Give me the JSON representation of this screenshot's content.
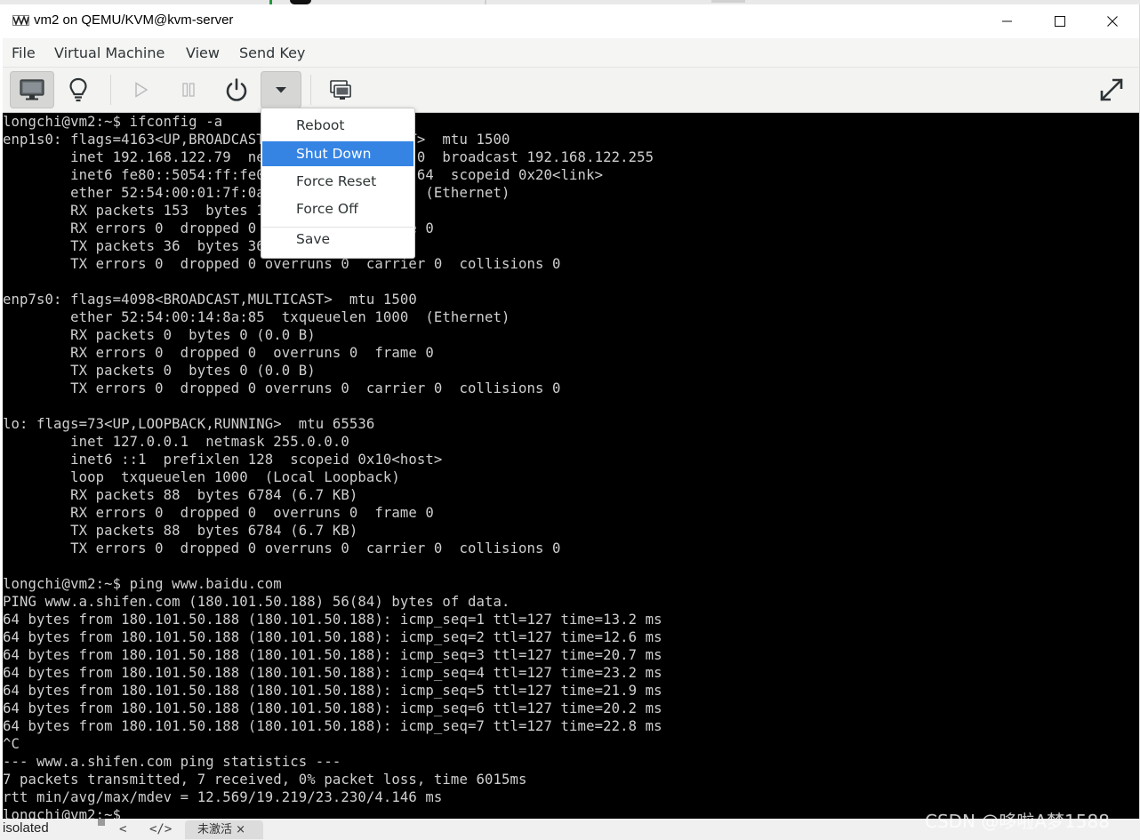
{
  "window": {
    "title": "vm2 on QEMU/KVM@kvm-server",
    "app_icon": "virt-manager-icon"
  },
  "menubar": {
    "items": [
      "File",
      "Virtual Machine",
      "View",
      "Send Key"
    ]
  },
  "toolbar": {
    "buttons": [
      "console-monitor",
      "details-lightbulb",
      "run",
      "pause",
      "power",
      "shutdown-dropdown",
      "snapshots",
      "fullscreen"
    ],
    "active": "console-monitor"
  },
  "shutdown_menu": {
    "items": [
      "Reboot",
      "Shut Down",
      "Force Reset",
      "Force Off",
      "Save"
    ],
    "highlighted": "Shut Down",
    "highlight_color": "#3584e4"
  },
  "console": {
    "text_color": "#cfcfcf",
    "background": "#000000",
    "lines": [
      "longchi@vm2:~$ ifconfig -a",
      "enp1s0: flags=4163<UP,BROADCAST,RUNNING,MULTICAST>  mtu 1500",
      "        inet 192.168.122.79  netmask 255.255.255.0  broadcast 192.168.122.255",
      "        inet6 fe80::5054:ff:fe01:7f0a  prefixlen 64  scopeid 0x20<link>",
      "        ether 52:54:00:01:7f:0a  txqueuelen 1000  (Ethernet)",
      "        RX packets 153  bytes 16520 (16.5 KB)",
      "        RX errors 0  dropped 0  overruns 0  frame 0",
      "        TX packets 36  bytes 3608 (3.6 KB)",
      "        TX errors 0  dropped 0 overruns 0  carrier 0  collisions 0",
      "",
      "enp7s0: flags=4098<BROADCAST,MULTICAST>  mtu 1500",
      "        ether 52:54:00:14:8a:85  txqueuelen 1000  (Ethernet)",
      "        RX packets 0  bytes 0 (0.0 B)",
      "        RX errors 0  dropped 0  overruns 0  frame 0",
      "        TX packets 0  bytes 0 (0.0 B)",
      "        TX errors 0  dropped 0 overruns 0  carrier 0  collisions 0",
      "",
      "lo: flags=73<UP,LOOPBACK,RUNNING>  mtu 65536",
      "        inet 127.0.0.1  netmask 255.0.0.0",
      "        inet6 ::1  prefixlen 128  scopeid 0x10<host>",
      "        loop  txqueuelen 1000  (Local Loopback)",
      "        RX packets 88  bytes 6784 (6.7 KB)",
      "        RX errors 0  dropped 0  overruns 0  frame 0",
      "        TX packets 88  bytes 6784 (6.7 KB)",
      "        TX errors 0  dropped 0 overruns 0  carrier 0  collisions 0",
      "",
      "longchi@vm2:~$ ping www.baidu.com",
      "PING www.a.shifen.com (180.101.50.188) 56(84) bytes of data.",
      "64 bytes from 180.101.50.188 (180.101.50.188): icmp_seq=1 ttl=127 time=13.2 ms",
      "64 bytes from 180.101.50.188 (180.101.50.188): icmp_seq=2 ttl=127 time=12.6 ms",
      "64 bytes from 180.101.50.188 (180.101.50.188): icmp_seq=3 ttl=127 time=20.7 ms",
      "64 bytes from 180.101.50.188 (180.101.50.188): icmp_seq=4 ttl=127 time=23.2 ms",
      "64 bytes from 180.101.50.188 (180.101.50.188): icmp_seq=5 ttl=127 time=21.9 ms",
      "64 bytes from 180.101.50.188 (180.101.50.188): icmp_seq=6 ttl=127 time=20.2 ms",
      "64 bytes from 180.101.50.188 (180.101.50.188): icmp_seq=7 ttl=127 time=22.8 ms",
      "^C",
      "--- www.a.shifen.com ping statistics ---",
      "7 packets transmitted, 7 received, 0% packet loss, time 6015ms",
      "rtt min/avg/max/mdev = 12.569/19.219/23.230/4.146 ms",
      "longchi@vm2:~$"
    ]
  },
  "statusbar": {
    "network": "isolated"
  },
  "editor_tab": {
    "label": "未激活 ×"
  },
  "editor_nav": {
    "back": "<",
    "code": "</>"
  },
  "watermark": "CSDN @哆啦A梦1588"
}
